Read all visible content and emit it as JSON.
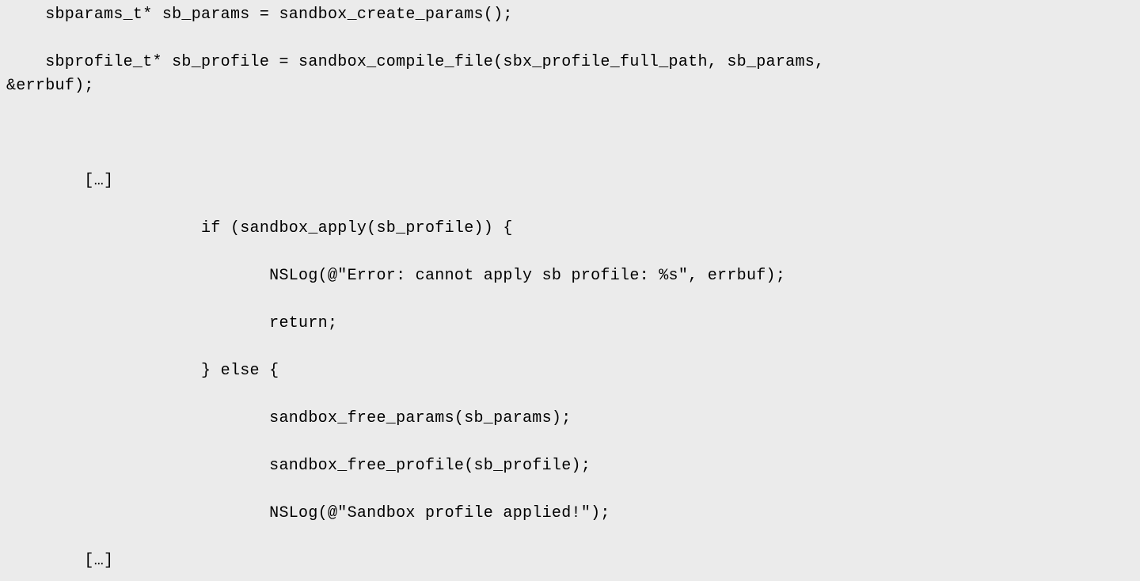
{
  "code": {
    "lines": [
      "    sbparams_t* sb_params = sandbox_create_params();",
      "",
      "    sbprofile_t* sb_profile = sandbox_compile_file(sbx_profile_full_path, sb_params,",
      "&errbuf);",
      "",
      "",
      "",
      "        […]",
      "",
      "                    if (sandbox_apply(sb_profile)) {",
      "",
      "                           NSLog(@\"Error: cannot apply sb profile: %s\", errbuf);",
      "",
      "                           return;",
      "",
      "                    } else {",
      "",
      "                           sandbox_free_params(sb_params);",
      "",
      "                           sandbox_free_profile(sb_profile);",
      "",
      "                           NSLog(@\"Sandbox profile applied!\");",
      "",
      "        […]"
    ]
  }
}
